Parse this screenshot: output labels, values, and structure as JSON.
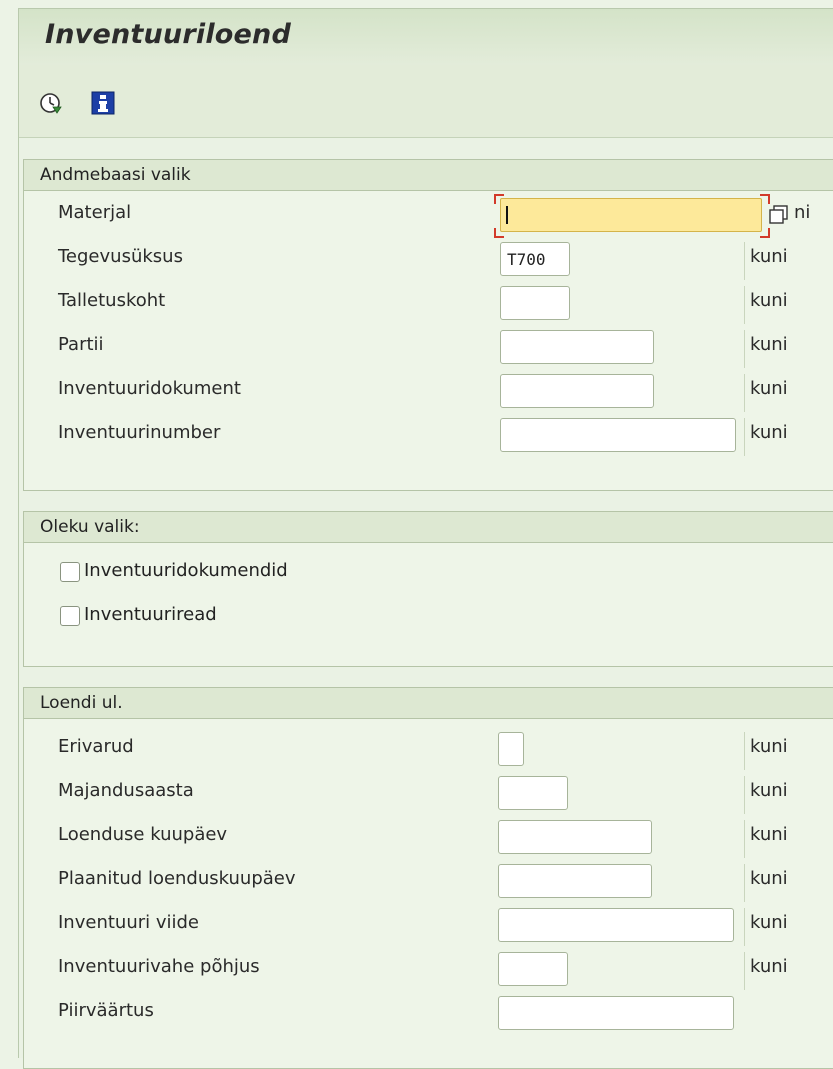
{
  "title": "Inventuuriloend",
  "toolbar": {
    "execute_icon": "execute-clock-icon",
    "info_icon": "info-icon"
  },
  "db_selection": {
    "header": "Andmebaasi valik",
    "fields": [
      {
        "label": "Materjal",
        "value": "",
        "kuni": "ni"
      },
      {
        "label": "Tegevusüksus",
        "value": "T700",
        "kuni": "kuni"
      },
      {
        "label": "Talletuskoht",
        "value": "",
        "kuni": "kuni"
      },
      {
        "label": "Partii",
        "value": "",
        "kuni": "kuni"
      },
      {
        "label": "Inventuuridokument",
        "value": "",
        "kuni": "kuni"
      },
      {
        "label": "Inventuurinumber",
        "value": "",
        "kuni": "kuni"
      }
    ]
  },
  "status_selection": {
    "header": "Oleku valik:",
    "checkboxes": [
      {
        "label": "Inventuuridokumendid",
        "checked": false
      },
      {
        "label": "Inventuuriread",
        "checked": false
      }
    ]
  },
  "list_scope": {
    "header": "Loendi ul.",
    "fields": [
      {
        "label": "Erivarud",
        "value": "",
        "kuni": "kuni"
      },
      {
        "label": "Majandusaasta",
        "value": "",
        "kuni": "kuni"
      },
      {
        "label": "Loenduse kuupäev",
        "value": "",
        "kuni": "kuni"
      },
      {
        "label": "Plaanitud loenduskuupäev",
        "value": "",
        "kuni": "kuni"
      },
      {
        "label": "Inventuuri viide",
        "value": "",
        "kuni": "kuni"
      },
      {
        "label": "Inventuurivahe põhjus",
        "value": "",
        "kuni": "kuni"
      },
      {
        "label": "Piirväärtus",
        "value": ""
      }
    ]
  },
  "colors": {
    "background": "#ecf3e6",
    "active_field": "#fde99a",
    "focus_corners": "#d23a2a",
    "info_icon": "#1d3fa6"
  }
}
